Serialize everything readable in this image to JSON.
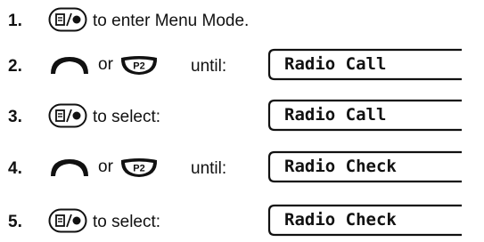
{
  "steps": [
    {
      "number": "1.",
      "icons": [
        "menu-select-icon"
      ],
      "text": "to enter Menu Mode.",
      "display": ""
    },
    {
      "number": "2.",
      "icons": [
        "arrow-up-icon",
        "p2-button-icon"
      ],
      "connector": "or",
      "text": "until:",
      "display": "Radio Call"
    },
    {
      "number": "3.",
      "icons": [
        "menu-select-icon"
      ],
      "text": "to select:",
      "display": "Radio Call"
    },
    {
      "number": "4.",
      "icons": [
        "arrow-up-icon",
        "p2-button-icon"
      ],
      "connector": "or",
      "text": "until:",
      "display": "Radio Check"
    },
    {
      "number": "5.",
      "icons": [
        "menu-select-icon"
      ],
      "text": "to select:",
      "display": "Radio Check"
    }
  ],
  "icon_glyphs": {
    "menu_select": "▤/●",
    "p2": "P2"
  },
  "colors": {
    "text": "#111111",
    "display_border": "#111111"
  }
}
